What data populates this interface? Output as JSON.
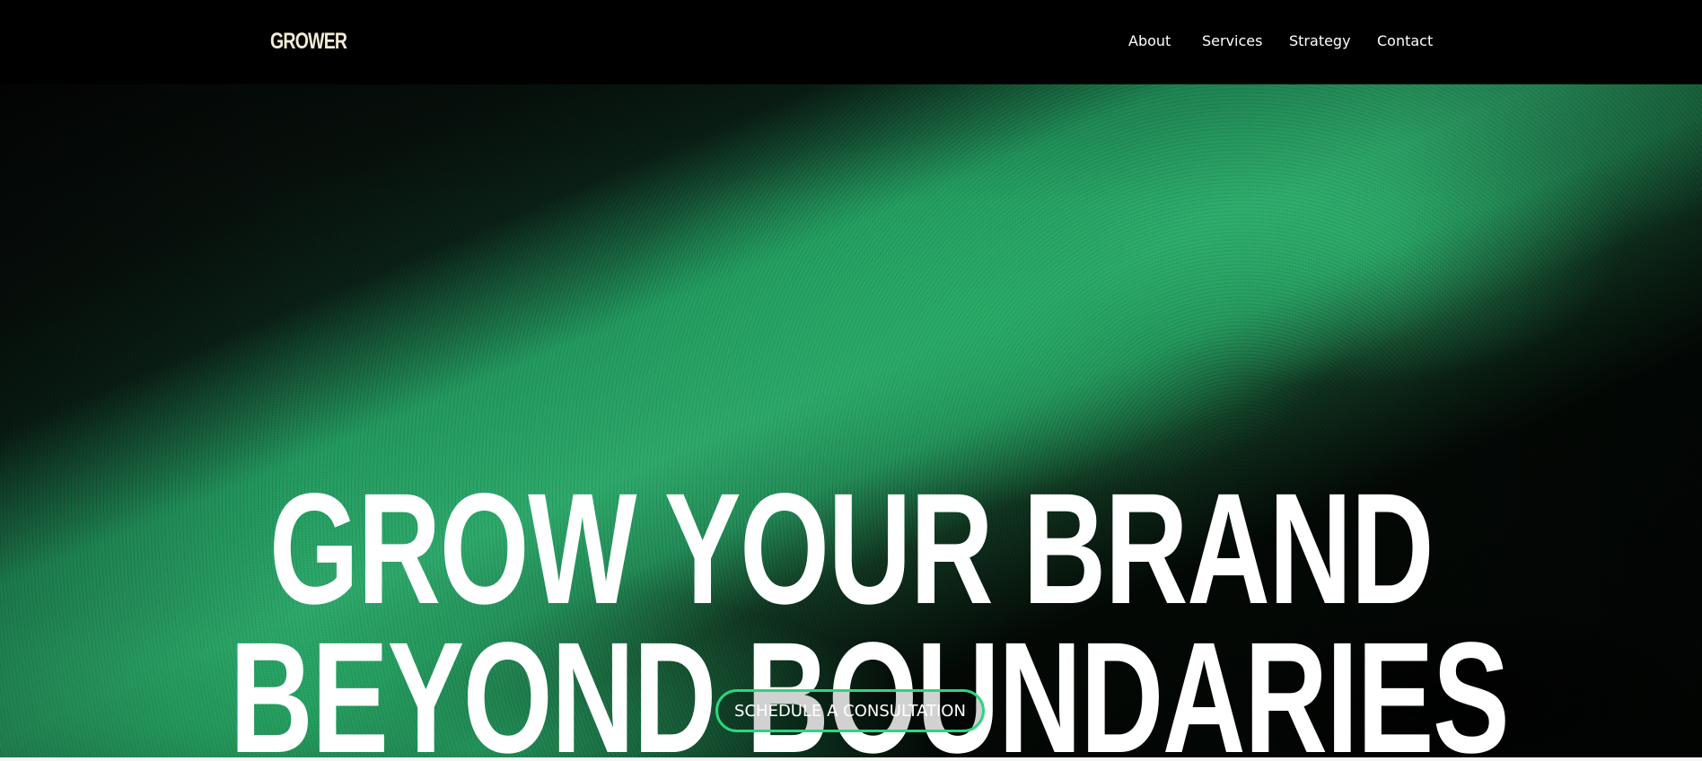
{
  "header": {
    "logo": "GROWER",
    "nav": {
      "about": "About",
      "services": "Services",
      "strategy": "Strategy",
      "contact": "Contact"
    }
  },
  "hero": {
    "title_line_1": "GROW YOUR BRAND",
    "title_line_2": "BEYOND BOUNDARIES",
    "cta_label": "SCHEDULE A CONSULTATION",
    "background": "green-noise-gradient"
  },
  "colors": {
    "background": "#000000",
    "accent": "#2bd680",
    "hero_green": "#2ea76b",
    "logo_text": "#f3ebd5",
    "text": "#ffffff"
  }
}
